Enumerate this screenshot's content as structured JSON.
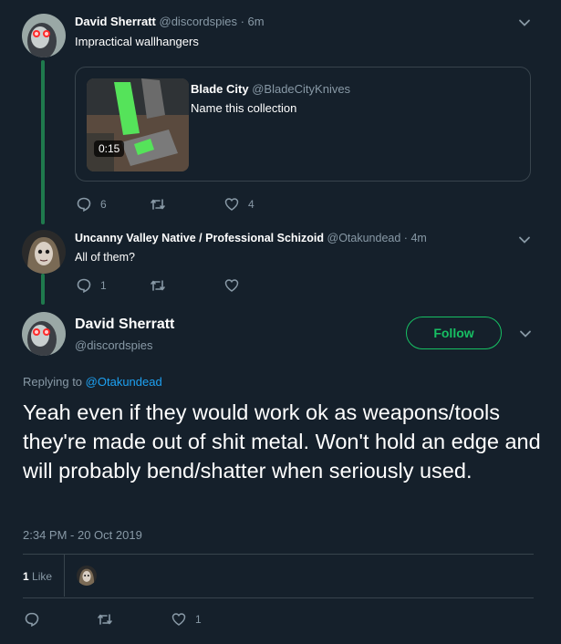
{
  "tweet1": {
    "author_name": "David Sherratt",
    "handle": "@discordspies",
    "separator": "·",
    "time": "6m",
    "text": "Impractical wallhangers",
    "quote": {
      "author_name": "Blade City",
      "handle": "@BladeCityKnives",
      "text": "Name this collection",
      "video_duration": "0:15"
    },
    "replies": "6",
    "retweets": "",
    "likes": "4"
  },
  "tweet2": {
    "author_name": "Uncanny Valley Native / Professional Schizoid",
    "handle": "@Otakundead",
    "separator": "·",
    "time": "4m",
    "text": "All of them?",
    "replies": "1",
    "retweets": "",
    "likes": ""
  },
  "focused": {
    "author_name": "David Sherratt",
    "handle": "@discordspies",
    "follow_label": "Follow",
    "replying_prefix": "Replying to",
    "replying_handle": "@Otakundead",
    "text": "Yeah even if they would work ok as weapons/tools they're made out of shit metal. Won't hold an edge and will probably bend/shatter when seriously used.",
    "timestamp": "2:34 PM - 20 Oct 2019",
    "like_count": "1",
    "like_label": "Like",
    "bottom_likes": "1"
  },
  "colors": {
    "background": "#15202b",
    "accent": "#1da1f2",
    "follow": "#17bf63",
    "thread_line": "#1f7a4d",
    "muted": "#8899a6"
  }
}
